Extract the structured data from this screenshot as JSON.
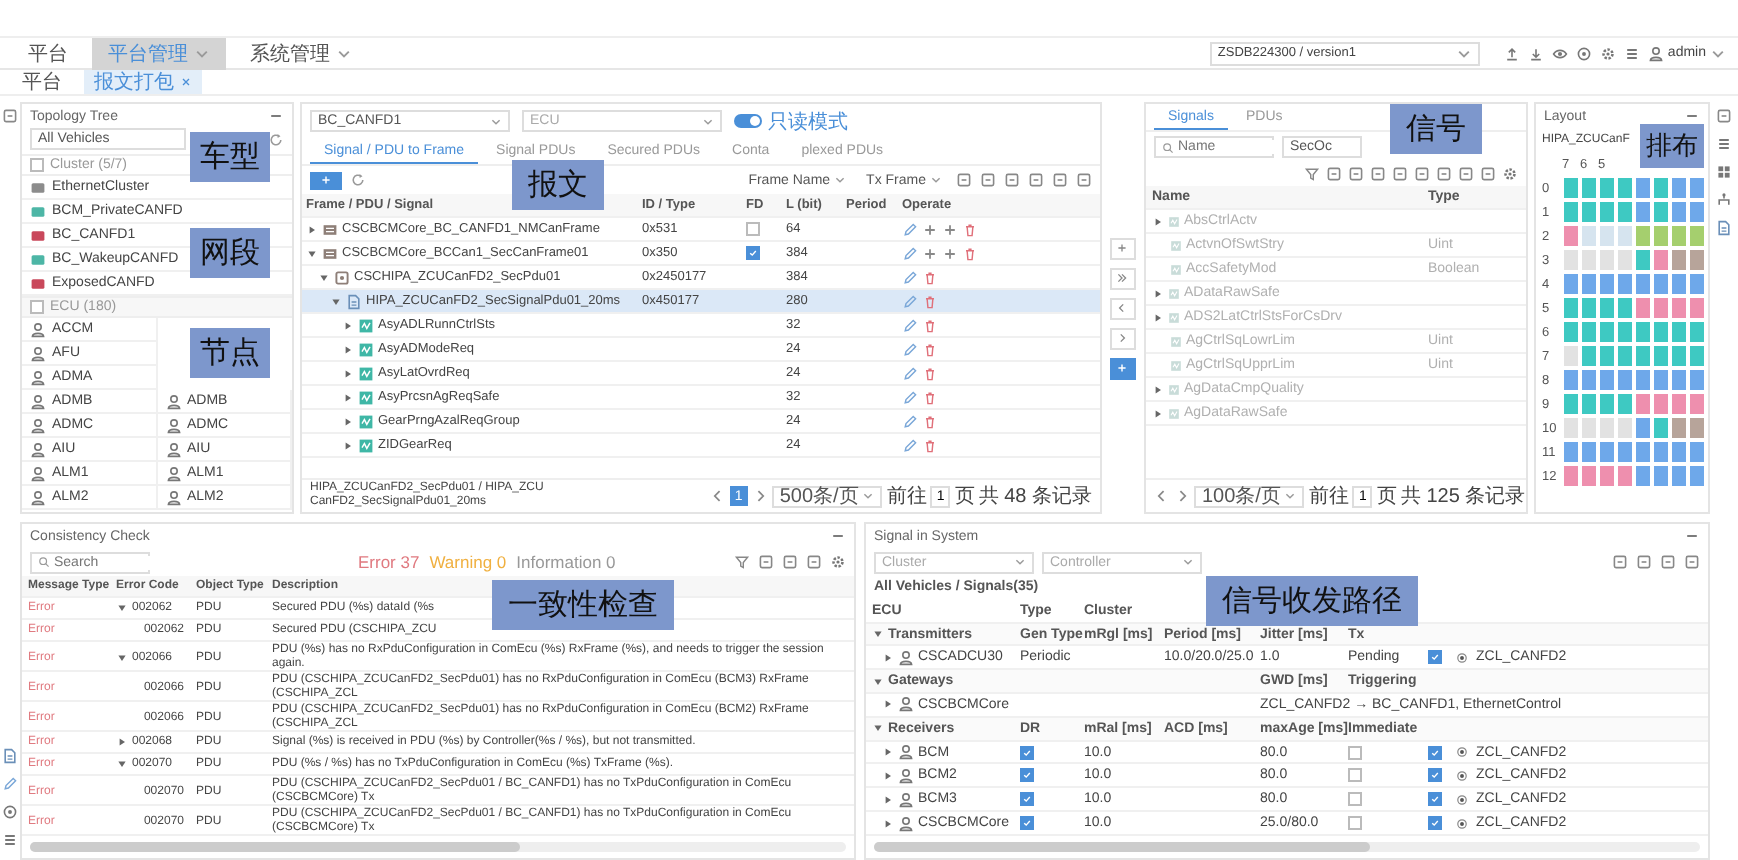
{
  "nav": {
    "items": [
      {
        "label": "平台",
        "selected": false,
        "dropdown": false
      },
      {
        "label": "平台管理",
        "selected": true,
        "dropdown": true
      },
      {
        "label": "系统管理",
        "selected": false,
        "dropdown": true
      }
    ],
    "version": "ZSDB224300 / version1",
    "user": "admin"
  },
  "page_tabs": [
    {
      "label": "平台",
      "selected": false,
      "closable": false
    },
    {
      "label": "报文打包",
      "selected": true,
      "closable": true
    }
  ],
  "topology": {
    "title": "Topology Tree",
    "vehicle": "All Vehicles",
    "cluster_header": "Cluster (5/7)",
    "clusters": [
      {
        "name": "EthernetCluster",
        "color": "#8c8c8c"
      },
      {
        "name": "BCM_PrivateCANFD",
        "color": "#4db6a6"
      },
      {
        "name": "BC_CANFD1",
        "color": "#c9485b"
      },
      {
        "name": "BC_WakeupCANFD",
        "color": "#4db6a6"
      },
      {
        "name": "ExposedCANFD",
        "color": "#c9485b"
      }
    ],
    "ecu_header": "ECU (180)",
    "ecus": [
      {
        "left": "ACCM"
      },
      {
        "left": "AFU"
      },
      {
        "left": "ADMA"
      },
      {
        "left": "ADMB",
        "right": "ADMB"
      },
      {
        "left": "ADMC",
        "right": "ADMC"
      },
      {
        "left": "AIU",
        "right": "AIU"
      },
      {
        "left": "ALM1",
        "right": "ALM1"
      },
      {
        "left": "ALM2",
        "right": "ALM2"
      }
    ],
    "annotations": [
      "车型",
      "网段",
      "节点"
    ]
  },
  "frames": {
    "cluster": "BC_CANFD1",
    "ecu_placeholder": "ECU",
    "toggle": {
      "on": true,
      "label": "只读模式"
    },
    "tabs": [
      {
        "label": "Signal / PDU to Frame",
        "selected": true
      },
      {
        "label": "Signal PDUs",
        "selected": false
      },
      {
        "label": "Secured PDUs",
        "selected": false
      },
      {
        "label": "Conta",
        "selected": false
      },
      {
        "label": "plexed PDUs",
        "selected": false
      }
    ],
    "filter_field": "Frame Name",
    "filter_value": "Tx Frame",
    "columns": [
      "Frame / PDU / Signal",
      "ID / Type",
      "FD",
      "L (bit)",
      "Period",
      "Operate"
    ],
    "rows": [
      {
        "kind": "frame",
        "name": "CSCBCMCore_BC_CANFD1_NMCanFrame",
        "id": "0x531",
        "fd": false,
        "length": "64",
        "expanded": false,
        "selected": false
      },
      {
        "kind": "frame",
        "name": "CSCBCMCore_BCCan1_SecCanFrame01",
        "id": "0x350",
        "fd": true,
        "length": "384",
        "expanded": true,
        "selected": false,
        "children": [
          {
            "kind": "pdu",
            "name": "CSCHIPA_ZCUCanFD2_SecPdu01",
            "id": "0x2450177",
            "length": "384",
            "expanded": true,
            "selected": false,
            "children": [
              {
                "kind": "signal_pdu",
                "name": "HIPA_ZCUCanFD2_SecSignalPdu01_20ms",
                "id": "0x450177",
                "length": "280",
                "expanded": true,
                "selected": true,
                "children": [
                  {
                    "kind": "signal",
                    "name": "AsyADLRunnCtrlSts",
                    "length": "32",
                    "expanded": false,
                    "selected": false
                  },
                  {
                    "kind": "signal",
                    "name": "AsyADModeReq",
                    "length": "24",
                    "expanded": false,
                    "selected": false
                  },
                  {
                    "kind": "signal",
                    "name": "AsyLatOvrdReq",
                    "length": "24",
                    "expanded": false,
                    "selected": false
                  },
                  {
                    "kind": "signal",
                    "name": "AsyPrcsnAgReqSafe",
                    "length": "32",
                    "expanded": false,
                    "selected": false
                  },
                  {
                    "kind": "signal",
                    "name": "GearPrngAzalReqGroup",
                    "length": "24",
                    "expanded": false,
                    "selected": false
                  },
                  {
                    "kind": "signal",
                    "name": "ZIDGearReq",
                    "length": "24",
                    "expanded": false,
                    "selected": false
                  }
                ]
              }
            ]
          }
        ]
      }
    ],
    "breadcrumb": "HIPA_ZCUCanFD2_SecPdu01 / HIPA_ZCUCanFD2_SecSignalPdu01_20ms",
    "pager": {
      "page": "1",
      "per_page": "500条/页",
      "goto": "前往",
      "goto_value": "1",
      "page_unit": "页",
      "total": "共 48 条记录"
    },
    "annotation": "报文"
  },
  "signals": {
    "tabs": [
      {
        "label": "Signals",
        "selected": true
      },
      {
        "label": "PDUs",
        "selected": false
      }
    ],
    "search_placeholder": "Name",
    "filter": "SecOc",
    "columns": [
      "Name",
      "Type"
    ],
    "rows": [
      {
        "kind": "group",
        "name": "AbsCtrlActv"
      },
      {
        "kind": "signal",
        "name": "ActvnOfSwtStry",
        "type": "Uint"
      },
      {
        "kind": "signal",
        "name": "AccSafetyMod",
        "type": "Boolean"
      },
      {
        "kind": "group",
        "name": "ADataRawSafe"
      },
      {
        "kind": "group",
        "name": "ADS2LatCtrlStsForCsDrv"
      },
      {
        "kind": "signal",
        "name": "AgCtrlSqLowrLim",
        "type": "Uint"
      },
      {
        "kind": "signal",
        "name": "AgCtrlSqUpprLim",
        "type": "Uint"
      },
      {
        "kind": "group",
        "name": "AgDataCmpQuality"
      },
      {
        "kind": "group",
        "name": "AgDataRawSafe"
      }
    ],
    "pager": {
      "per_page": "100条/页",
      "goto": "前往",
      "goto_value": "1",
      "page_unit": "页",
      "total": "共 125 条记录"
    },
    "annotation": "信号"
  },
  "layout": {
    "title": "Layout",
    "pdu": "HIPA_ZCUCanF",
    "bit_headers": [
      "7",
      "6",
      "5"
    ],
    "rows": [
      {
        "label": "0",
        "cells": [
          {
            "color": "#3ec9c2"
          },
          {
            "color": "#3ec9c2"
          },
          {
            "color": "#3ec9c2"
          },
          {
            "color": "#3ec9c2"
          },
          {
            "color": "#6ea8ea"
          },
          {
            "color": "#3ec9c2"
          },
          {
            "color": "#6ea8ea"
          },
          {
            "color": "#6ea8ea"
          }
        ]
      },
      {
        "label": "1",
        "cells": [
          {
            "color": "#3ec9c2"
          },
          {
            "color": "#3ec9c2"
          },
          {
            "color": "#3ec9c2"
          },
          {
            "color": "#3ec9c2"
          },
          {
            "color": "#6ea8ea"
          },
          {
            "color": "#3ec9c2"
          },
          {
            "color": "#6ea8ea"
          },
          {
            "color": "#6ea8ea"
          }
        ]
      },
      {
        "label": "2",
        "cells": [
          {
            "color": "#ee8fae"
          },
          {
            "color": "#d6e4ef"
          },
          {
            "color": "#d6e4ef"
          },
          {
            "color": "#d6e4ef"
          },
          {
            "color": "#a5cf6e"
          },
          {
            "color": "#a5cf6e"
          },
          {
            "color": "#a5cf6e"
          },
          {
            "color": "#a5cf6e"
          }
        ]
      },
      {
        "label": "3",
        "cells": [
          {
            "color": "#e2e2e2"
          },
          {
            "color": "#e2e2e2"
          },
          {
            "color": "#e2e2e2"
          },
          {
            "color": "#e2e2e2"
          },
          {
            "color": "#3ec9c2"
          },
          {
            "color": "#ee8fae"
          },
          {
            "color": "#b7a49a"
          },
          {
            "color": "#b7a49a"
          }
        ]
      },
      {
        "label": "4",
        "cells": [
          {
            "color": "#6ea8ea"
          },
          {
            "color": "#6ea8ea"
          },
          {
            "color": "#6ea8ea"
          },
          {
            "color": "#6ea8ea"
          },
          {
            "color": "#6ea8ea"
          },
          {
            "color": "#6ea8ea"
          },
          {
            "color": "#6ea8ea"
          },
          {
            "color": "#6ea8ea"
          }
        ]
      },
      {
        "label": "5",
        "cells": [
          {
            "color": "#3ec9c2"
          },
          {
            "color": "#3ec9c2"
          },
          {
            "color": "#3ec9c2"
          },
          {
            "color": "#3ec9c2"
          },
          {
            "color": "#ee8fae"
          },
          {
            "color": "#ee8fae"
          },
          {
            "color": "#ee8fae"
          },
          {
            "color": "#ee8fae"
          }
        ]
      },
      {
        "label": "6",
        "cells": [
          {
            "color": "#3ec9c2"
          },
          {
            "color": "#3ec9c2"
          },
          {
            "color": "#3ec9c2"
          },
          {
            "color": "#3ec9c2"
          },
          {
            "color": "#3ec9c2"
          },
          {
            "color": "#3ec9c2"
          },
          {
            "color": "#3ec9c2"
          },
          {
            "color": "#3ec9c2"
          }
        ]
      },
      {
        "label": "7",
        "cells": [
          {
            "color": "#e2e2e2"
          },
          {
            "color": "#3ec9c2"
          },
          {
            "color": "#3ec9c2"
          },
          {
            "color": "#3ec9c2"
          },
          {
            "color": "#3ec9c2"
          },
          {
            "color": "#3ec9c2"
          },
          {
            "color": "#3ec9c2"
          },
          {
            "color": "#3ec9c2"
          }
        ]
      },
      {
        "label": "8",
        "cells": [
          {
            "color": "#6ea8ea"
          },
          {
            "color": "#6ea8ea"
          },
          {
            "color": "#6ea8ea"
          },
          {
            "color": "#6ea8ea"
          },
          {
            "color": "#6ea8ea"
          },
          {
            "color": "#6ea8ea"
          },
          {
            "color": "#6ea8ea"
          },
          {
            "color": "#6ea8ea"
          }
        ]
      },
      {
        "label": "9",
        "cells": [
          {
            "color": "#3ec9c2"
          },
          {
            "color": "#3ec9c2"
          },
          {
            "color": "#3ec9c2"
          },
          {
            "color": "#3ec9c2"
          },
          {
            "color": "#ee8fae"
          },
          {
            "color": "#ee8fae"
          },
          {
            "color": "#ee8fae"
          },
          {
            "color": "#ee8fae"
          }
        ]
      },
      {
        "label": "10",
        "cells": [
          {
            "color": "#e2e2e2"
          },
          {
            "color": "#e2e2e2"
          },
          {
            "color": "#e2e2e2"
          },
          {
            "color": "#e2e2e2"
          },
          {
            "color": "#6ea8ea"
          },
          {
            "color": "#3ec9c2"
          },
          {
            "color": "#b7a49a"
          },
          {
            "color": "#b7a49a"
          }
        ]
      },
      {
        "label": "11",
        "cells": [
          {
            "color": "#6ea8ea"
          },
          {
            "color": "#6ea8ea"
          },
          {
            "color": "#6ea8ea"
          },
          {
            "color": "#6ea8ea"
          },
          {
            "color": "#6ea8ea"
          },
          {
            "color": "#6ea8ea"
          },
          {
            "color": "#6ea8ea"
          },
          {
            "color": "#6ea8ea"
          }
        ]
      },
      {
        "label": "12",
        "cells": [
          {
            "color": "#ee8fae"
          },
          {
            "color": "#ee8fae"
          },
          {
            "color": "#ee8fae"
          },
          {
            "color": "#ee8fae"
          },
          {
            "color": "#6ea8ea"
          },
          {
            "color": "#6ea8ea"
          },
          {
            "color": "#6ea8ea"
          },
          {
            "color": "#6ea8ea"
          }
        ]
      }
    ],
    "annotation": "排布"
  },
  "consistency": {
    "title": "Consistency Check",
    "search_placeholder": "Search",
    "counts": [
      {
        "kind": "error",
        "label": "Error 37"
      },
      {
        "kind": "warning",
        "label": "Warning 0"
      },
      {
        "kind": "info",
        "label": "Information 0"
      }
    ],
    "columns": [
      "Message Type",
      "Error Code",
      "Object Type",
      "Description"
    ],
    "rows": [
      {
        "type": "Error",
        "code": "002062",
        "object": "PDU",
        "description": "Secured PDU (%s) dataId (%s",
        "expanded": true,
        "children": [
          {
            "type": "Error",
            "code": "002062",
            "object": "PDU",
            "description": "Secured PDU (CSCHIPA_ZCU"
          }
        ]
      },
      {
        "type": "Error",
        "code": "002066",
        "object": "PDU",
        "description": "PDU (%s) has no RxPduConfiguration in ComEcu (%s) RxFrame (%s), and needs to trigger the session again.",
        "expanded": true,
        "children": [
          {
            "type": "Error",
            "code": "002066",
            "object": "PDU",
            "description": "PDU (CSCHIPA_ZCUCanFD2_SecPdu01) has no RxPduConfiguration in ComEcu (BCM3) RxFrame (CSCHIPA_ZCL"
          },
          {
            "type": "Error",
            "code": "002066",
            "object": "PDU",
            "description": "PDU (CSCHIPA_ZCUCanFD2_SecPdu01) has no RxPduConfiguration in ComEcu (BCM2) RxFrame (CSCHIPA_ZCL"
          }
        ]
      },
      {
        "type": "Error",
        "code": "002068",
        "object": "PDU",
        "description": "Signal (%s) is received in PDU (%s) by Controller(%s / %s), but not transmitted.",
        "expanded": false
      },
      {
        "type": "Error",
        "code": "002070",
        "object": "PDU",
        "description": "PDU (%s / %s) has no TxPduConfiguration in ComEcu (%s) TxFrame (%s).",
        "expanded": true,
        "children": [
          {
            "type": "Error",
            "code": "002070",
            "object": "PDU",
            "description": "PDU (CSCHIPA_ZCUCanFD2_SecPdu01 / BC_CANFD1) has no TxPduConfiguration in ComEcu (CSCBCMCore) Tx"
          },
          {
            "type": "Error",
            "code": "002070",
            "object": "PDU",
            "description": "PDU (CSCHIPA_ZCUCanFD2_SecPdu01 / BC_CANFD1) has no TxPduConfiguration in ComEcu (CSCBCMCore) Tx"
          }
        ]
      }
    ],
    "annotation": "一致性检查"
  },
  "system": {
    "title": "Signal in System",
    "cluster_placeholder": "Cluster",
    "controller_placeholder": "Controller",
    "path": "All Vehicles / Signals(35)",
    "columns": [
      "ECU",
      "Type",
      "Cluster"
    ],
    "groups": [
      {
        "kind": "transmitters",
        "label": "Transmitters",
        "expanded": true,
        "headers": [
          "Gen Type",
          "mRgl [ms]",
          "Period [ms]",
          "Jitter [ms]",
          "Tx"
        ],
        "rows": [
          {
            "ecu": "CSCADCU30",
            "gen_type": "Periodic",
            "period": "10.0/20.0/25.0",
            "jitter": "1.0",
            "tx": "Pending",
            "checked": true,
            "cluster": "ZCL_CANFD2"
          }
        ]
      },
      {
        "kind": "gateways",
        "label": "Gateways",
        "expanded": true,
        "headers": [
          "GWD [ms]",
          "Triggering"
        ],
        "rows": [
          {
            "ecu": "CSCBCMCore",
            "route": "ZCL_CANFD2 → BC_CANFD1, EthernetControl"
          }
        ]
      },
      {
        "kind": "receivers",
        "label": "Receivers",
        "expanded": true,
        "headers": [
          "DR",
          "mRal [ms]",
          "ACD [ms]",
          "maxAge [ms]",
          "Immediate"
        ],
        "rows": [
          {
            "ecu": "BCM",
            "dr": true,
            "mral": "10.0",
            "max_age": "80.0",
            "immediate": false,
            "checked": true,
            "cluster": "ZCL_CANFD2"
          },
          {
            "ecu": "BCM2",
            "dr": true,
            "mral": "10.0",
            "max_age": "80.0",
            "immediate": false,
            "checked": true,
            "cluster": "ZCL_CANFD2"
          },
          {
            "ecu": "BCM3",
            "dr": true,
            "mral": "10.0",
            "max_age": "80.0",
            "immediate": false,
            "checked": true,
            "cluster": "ZCL_CANFD2"
          },
          {
            "ecu": "CSCBCMCore",
            "dr": true,
            "mral": "10.0",
            "max_age": "25.0/80.0",
            "immediate": false,
            "checked": true,
            "cluster": "ZCL_CANFD2"
          }
        ]
      }
    ],
    "annotation": "信号收发路径"
  }
}
